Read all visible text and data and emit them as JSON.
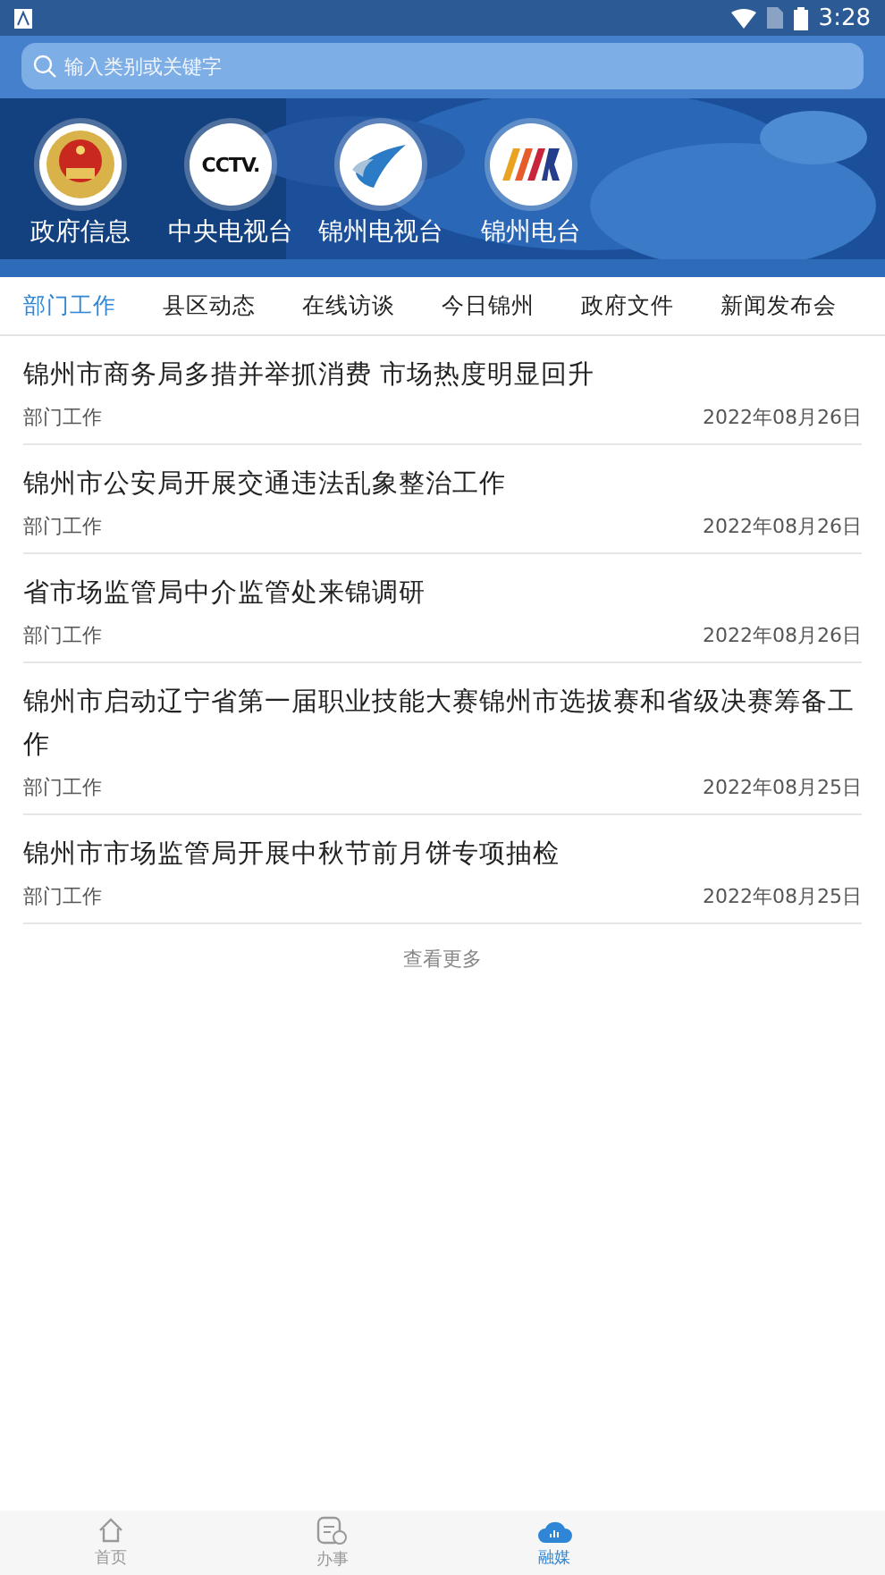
{
  "status_bar": {
    "time": "3:28"
  },
  "search": {
    "placeholder": "输入类别或关键字"
  },
  "channels": [
    {
      "kind": "emblem",
      "label": "政府信息"
    },
    {
      "kind": "cctv",
      "logo_text": "CCTV.",
      "label": "中央电视台"
    },
    {
      "kind": "swoosh",
      "label": "锦州电视台"
    },
    {
      "kind": "stripes",
      "label": "锦州电台"
    }
  ],
  "tabs": [
    {
      "label": "部门工作",
      "selected": true
    },
    {
      "label": "县区动态",
      "selected": false
    },
    {
      "label": "在线访谈",
      "selected": false
    },
    {
      "label": "今日锦州",
      "selected": false
    },
    {
      "label": "政府文件",
      "selected": false
    },
    {
      "label": "新闻发布会",
      "selected": false
    }
  ],
  "articles": [
    {
      "title": "锦州市商务局多措并举抓消费 市场热度明显回升",
      "category": "部门工作",
      "date": "2022年08月26日"
    },
    {
      "title": "锦州市公安局开展交通违法乱象整治工作",
      "category": "部门工作",
      "date": "2022年08月26日"
    },
    {
      "title": "省市场监管局中介监管处来锦调研",
      "category": "部门工作",
      "date": "2022年08月26日"
    },
    {
      "title": "锦州市启动辽宁省第一届职业技能大赛锦州市选拔赛和省级决赛筹备工作",
      "category": "部门工作",
      "date": "2022年08月25日"
    },
    {
      "title": "锦州市市场监管局开展中秋节前月饼专项抽检",
      "category": "部门工作",
      "date": "2022年08月25日"
    }
  ],
  "more": "查看更多",
  "bottom_nav": [
    {
      "kind": "home",
      "label": "首页",
      "selected": false
    },
    {
      "kind": "service",
      "label": "办事",
      "selected": false
    },
    {
      "kind": "cloud",
      "label": "融媒",
      "selected": true
    }
  ]
}
